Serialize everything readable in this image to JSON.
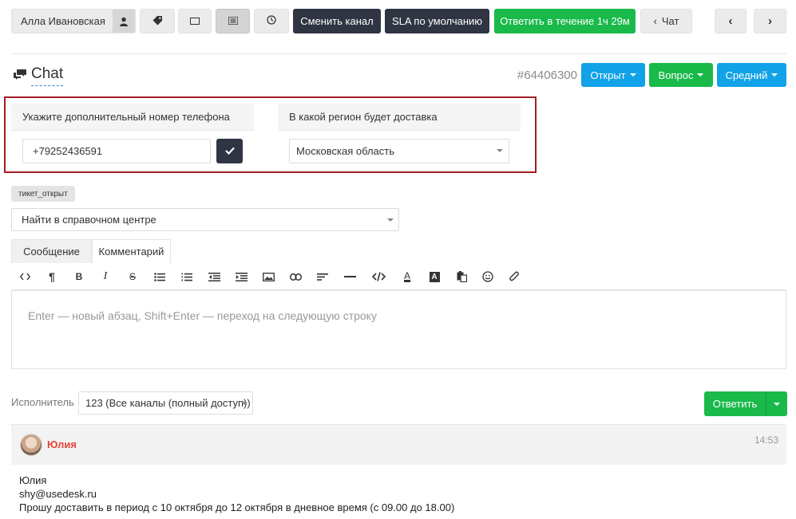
{
  "toolbar": {
    "user_name": "Алла Ивановская",
    "change_channel": "Сменить канал",
    "sla_default": "SLA по умолчанию",
    "reply_within": "Ответить в течение 1ч 29м",
    "chat_back": "Чат",
    "prev_symbol": "‹",
    "next_symbol": "›"
  },
  "header": {
    "title": "Chat",
    "ticket_id": "#64406300",
    "status_label": "Открыт",
    "type_label": "Вопрос",
    "priority_label": "Средний"
  },
  "form": {
    "phone_label": "Укажите дополнительный номер телефона",
    "phone_value": "+79252436591",
    "region_label": "В какой регион будет доставка",
    "region_value": "Московская область"
  },
  "tag": "тикет_открыт",
  "help_center": "Найти в справочном центре",
  "tabs": [
    "Сообщение",
    "Комментарий"
  ],
  "editor": {
    "placeholder": "Enter — новый абзац, Shift+Enter — переход на следующую строку"
  },
  "executor": {
    "label": "Исполнитель",
    "value": "123 (Все каналы (полный доступ))",
    "reply_button": "Ответить"
  },
  "message": {
    "author": "Юлия",
    "time": "14:53",
    "lines": [
      "Юлия",
      "shy@usedesk.ru",
      "Прошу доставить в период с 10 октября до 12 октября в дневное время (с 09.00 до 18.00)"
    ]
  },
  "colors": {
    "dark_button": "#2f3542",
    "green": "#1aba4a",
    "blue": "#12a2e7",
    "highlight_border": "#a21d22",
    "author_red": "#e8433b"
  }
}
